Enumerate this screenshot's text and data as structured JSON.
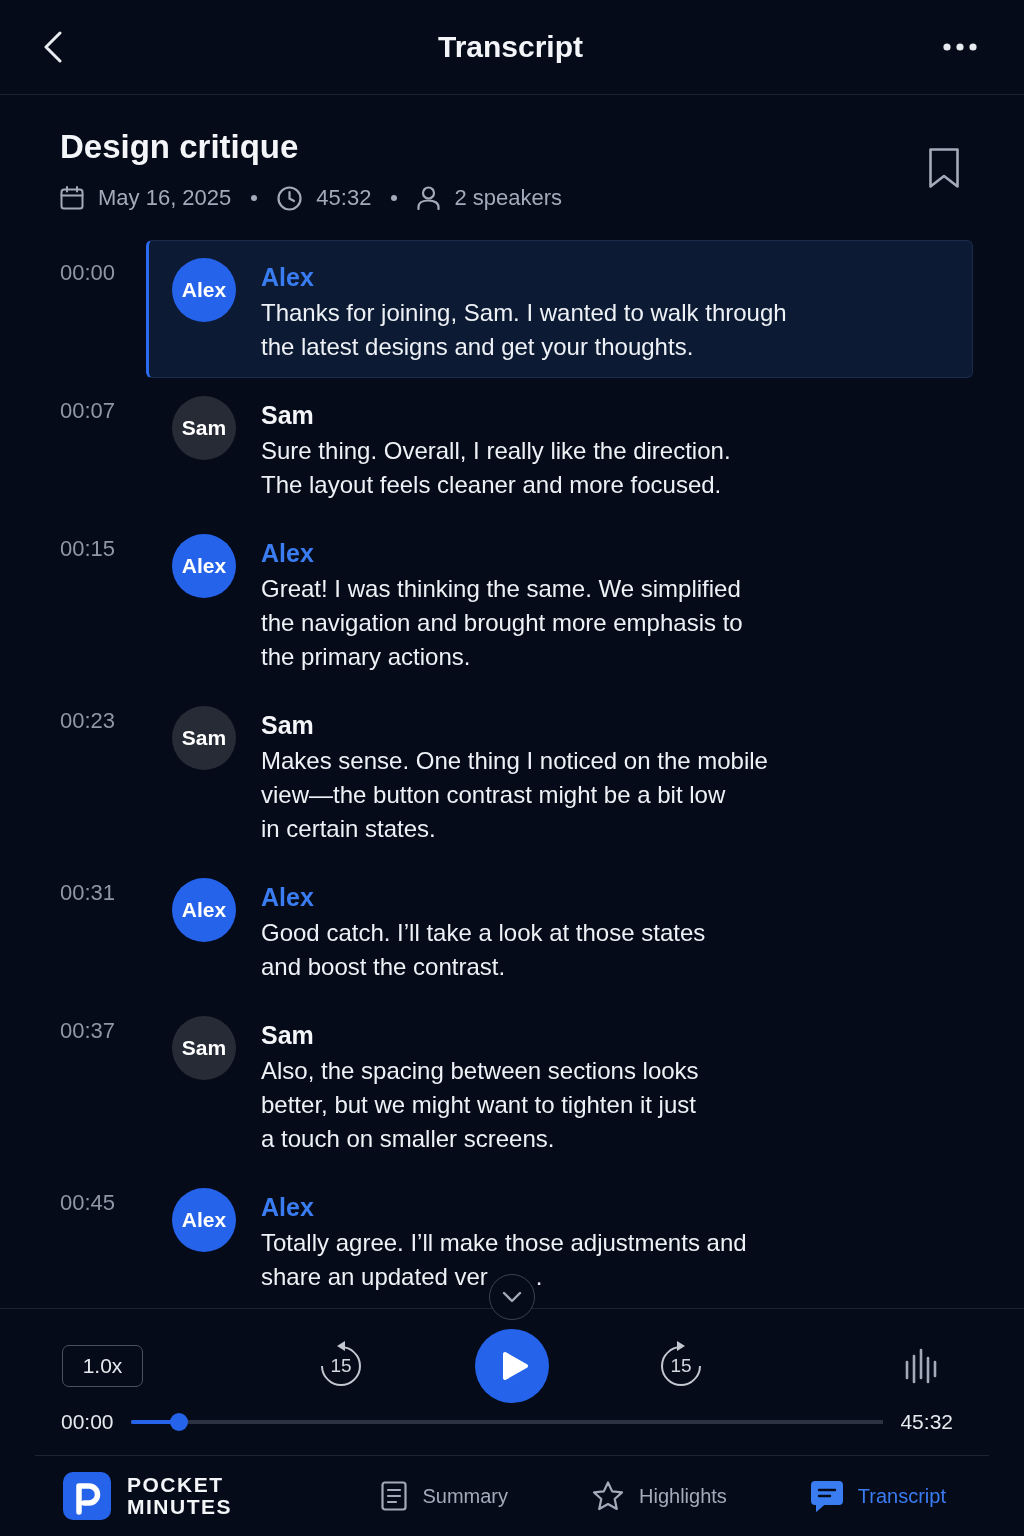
{
  "header": {
    "title": "Transcript"
  },
  "recording": {
    "title": "Design critique",
    "date": "May 16, 2025",
    "duration": "45:32",
    "speakers": "2 speakers",
    "bookmarked": false
  },
  "messages": [
    {
      "time": "00:00",
      "kind": "host",
      "avatar": "Alex",
      "speaker": "Alex",
      "lines": [
        "Thanks for joining, Sam. I wanted to walk through",
        "the latest designs and get your thoughts."
      ],
      "selected": true
    },
    {
      "time": "00:07",
      "kind": "guest",
      "avatar": "Sam",
      "speaker": "Sam",
      "lines": [
        "Sure thing. Overall, I really like the direction.",
        "The layout feels cleaner and more focused."
      ],
      "selected": false
    },
    {
      "time": "00:15",
      "kind": "host",
      "avatar": "Alex",
      "speaker": "Alex",
      "lines": [
        "Great! I was thinking the same. We simplified",
        "the navigation and brought more emphasis to",
        "the primary actions."
      ],
      "selected": false
    },
    {
      "time": "00:23",
      "kind": "guest",
      "avatar": "Sam",
      "speaker": "Sam",
      "lines": [
        "Makes sense. One thing I noticed on the mobile",
        "view—the button contrast might be a bit low",
        "in certain states."
      ],
      "selected": false
    },
    {
      "time": "00:31",
      "kind": "host",
      "avatar": "Alex",
      "speaker": "Alex",
      "lines": [
        "Good catch. I’ll take a look at those states",
        "and boost the contrast."
      ],
      "selected": false
    },
    {
      "time": "00:37",
      "kind": "guest",
      "avatar": "Sam",
      "speaker": "Sam",
      "lines": [
        "Also, the spacing between sections looks",
        "better, but we might want to tighten it just",
        "a touch on smaller screens."
      ],
      "selected": false
    },
    {
      "time": "00:45",
      "kind": "host",
      "avatar": "Alex",
      "speaker": "Alex",
      "lines": [
        "Totally agree. I’ll make those adjustments and",
        "share an updated ver"
      ],
      "tail": ".",
      "selected": false
    }
  ],
  "player": {
    "speed": "1.0x",
    "rewind": "15",
    "forward": "15",
    "playing": false,
    "elapsed": "00:00",
    "level": 0.064,
    "total": "45:32"
  },
  "brand": {
    "lines": [
      "POCKET",
      "MINUTES"
    ]
  },
  "tabs": [
    {
      "label": "Summary",
      "selected": false
    },
    {
      "label": "Highlights",
      "selected": false
    },
    {
      "label": "Transcript",
      "selected": true
    }
  ]
}
